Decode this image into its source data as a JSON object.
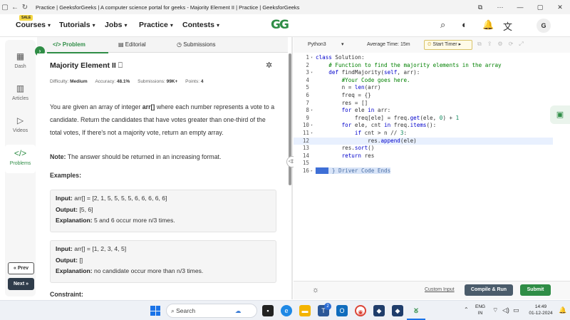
{
  "browser": {
    "tab_title": "Practice | GeeksforGeeks | A computer science portal for geeks - Majority Element II | Practice | GeeksforGeeks"
  },
  "header": {
    "sale_badge": "SALE",
    "nav": [
      "Courses",
      "Tutorials",
      "Jobs",
      "Practice",
      "Contests"
    ],
    "logo": "GG",
    "avatar": "G"
  },
  "rail": {
    "items": [
      "Dash",
      "Articles",
      "Videos",
      "Problems"
    ],
    "prev": "« Prev",
    "next": "Next »"
  },
  "problem_tabs": [
    "Problem",
    "Editorial",
    "Submissions"
  ],
  "problem": {
    "title": "Majority Element II",
    "difficulty_label": "Difficulty:",
    "difficulty": "Medium",
    "accuracy_label": "Accuracy:",
    "accuracy": "48.1%",
    "submissions_label": "Submissions:",
    "submissions": "99K+",
    "points_label": "Points:",
    "points": "4",
    "desc_pre": "You are given an array of integer ",
    "desc_bold": "arr[]",
    "desc_post": " where each number represents a vote to a candidate. Return the candidates that have votes greater than one-third of the total votes, If there's not a majority vote, return an empty array.",
    "note_label": "Note:",
    "note_text": " The answer should be returned in an increasing format.",
    "examples_heading": "Examples:",
    "examples": [
      {
        "input_label": "Input:",
        "input": " arr[] = [2, 1, 5, 5, 5, 5, 6, 6, 6, 6, 6]",
        "output_label": "Output:",
        "output": " [5, 6]",
        "expl_label": "Explanation:",
        "expl": " 5 and 6 occur more n/3 times."
      },
      {
        "input_label": "Input:",
        "input": " arr[] = [1, 2, 3, 4, 5]",
        "output_label": "Output:",
        "output": " []",
        "expl_label": "Explanation:",
        "expl": " no candidate occur more than n/3 times."
      }
    ],
    "constraint_heading": "Constraint:"
  },
  "editor": {
    "language": "Python3",
    "avg_time": "Average Time: 15m",
    "timer_label": "Start Timer",
    "line_numbers": [
      "1",
      "2",
      "3",
      "4",
      "5",
      "6",
      "7",
      "8",
      "9",
      "10",
      "11",
      "12",
      "13",
      "14",
      "15",
      "16"
    ],
    "custom_input": "Custom Input",
    "compile_label": "Compile & Run",
    "submit_label": "Submit"
  },
  "taskbar": {
    "search_placeholder": "Search",
    "lang": "ENG",
    "region": "IN",
    "time": "14:49",
    "date": "01-12-2024",
    "notification_count": "2"
  }
}
